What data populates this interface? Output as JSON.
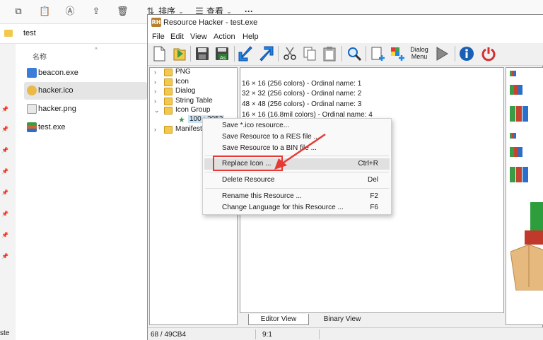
{
  "explorer": {
    "toolbar": {
      "sort_label": "排序",
      "view_label": "查看",
      "more_label": "···"
    },
    "address": {
      "path": "test"
    },
    "column_header": "名称",
    "files": [
      {
        "name": "beacon.exe",
        "icon": "exe-file-icon",
        "selected": false
      },
      {
        "name": "hacker.ico",
        "icon": "ico-file-icon",
        "selected": true
      },
      {
        "name": "hacker.png",
        "icon": "png-file-icon",
        "selected": false
      },
      {
        "name": "test.exe",
        "icon": "exe-file-icon",
        "selected": false
      }
    ],
    "left_pane_text": "ste"
  },
  "rh": {
    "title": "Resource Hacker - test.exe",
    "logo": "RH",
    "menu": [
      "File",
      "Edit",
      "View",
      "Action",
      "Help"
    ],
    "toolbar": {
      "dialog_menu_line1": "Dialog",
      "dialog_menu_line2": "Menu"
    },
    "tree": {
      "nodes": [
        {
          "label": "PNG",
          "expander": "›"
        },
        {
          "label": "Icon",
          "expander": "›"
        },
        {
          "label": "Dialog",
          "expander": "›"
        },
        {
          "label": "String Table",
          "expander": "›"
        },
        {
          "label": "Icon Group",
          "expander": "⌄"
        },
        {
          "label": "Manifest",
          "expander": "›"
        }
      ],
      "child": "100 : 2052"
    },
    "main_lines": [
      "16 × 16 (256 colors) - Ordinal name: 1",
      "32 × 32 (256 colors) - Ordinal name: 2",
      "48 × 48 (256 colors) - Ordinal name: 3",
      "16 × 16 (16.8mil colors) - Ordinal name: 4"
    ],
    "tabs": {
      "editor": "Editor View",
      "binary": "Binary View"
    },
    "status": {
      "position": "68 / 49CB4",
      "cursor": "9:1"
    }
  },
  "context_menu": {
    "items": [
      {
        "label": "Save *.ico resource...",
        "shortcut": ""
      },
      {
        "label": "Save Resource to a RES file ...",
        "shortcut": ""
      },
      {
        "label": "Save Resource to a BIN file ...",
        "shortcut": ""
      },
      {
        "label": "Replace Icon ...",
        "shortcut": "Ctrl+R"
      },
      {
        "label": "Delete Resource",
        "shortcut": "Del"
      },
      {
        "label": "Rename this Resource ...",
        "shortcut": "F2"
      },
      {
        "label": "Change Language for this Resource ...",
        "shortcut": "F6"
      }
    ]
  },
  "colors": {
    "highlight": "#e53935",
    "exit": "#d32f2f",
    "info": "#1a5fb4"
  }
}
